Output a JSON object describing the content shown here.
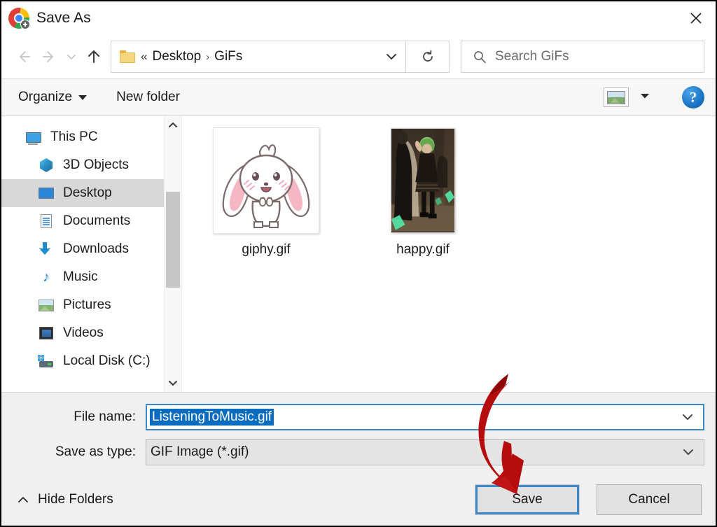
{
  "window": {
    "title": "Save As",
    "app_icon": "chrome-icon",
    "close_label": "✕"
  },
  "nav": {
    "back_icon": "arrow-left-icon",
    "forward_icon": "arrow-right-icon",
    "recent_icon": "chevron-down-icon",
    "up_icon": "arrow-up-icon",
    "refresh_icon": "refresh-icon",
    "address": {
      "folder_icon": "folder-icon",
      "prefix": "«",
      "crumbs": [
        "Desktop",
        "GiFs"
      ],
      "separator": "›",
      "dropdown_icon": "chevron-down-icon"
    },
    "search": {
      "icon": "search-icon",
      "placeholder": "Search GiFs",
      "value": ""
    }
  },
  "toolbar": {
    "organize_label": "Organize",
    "new_folder_label": "New folder",
    "view_icon": "picture-view-icon",
    "view_dropdown_icon": "chevron-down-icon",
    "help_label": "?",
    "help_icon": "help-icon"
  },
  "sidebar": {
    "items": [
      {
        "label": "This PC",
        "icon": "pc-icon",
        "indent": false,
        "selected": false
      },
      {
        "label": "3D Objects",
        "icon": "cube-icon",
        "indent": true,
        "selected": false
      },
      {
        "label": "Desktop",
        "icon": "desktop-icon",
        "indent": true,
        "selected": true
      },
      {
        "label": "Documents",
        "icon": "document-icon",
        "indent": true,
        "selected": false
      },
      {
        "label": "Downloads",
        "icon": "download-icon",
        "indent": true,
        "selected": false
      },
      {
        "label": "Music",
        "icon": "music-note-icon",
        "indent": true,
        "selected": false
      },
      {
        "label": "Pictures",
        "icon": "picture-icon",
        "indent": true,
        "selected": false
      },
      {
        "label": "Videos",
        "icon": "video-icon",
        "indent": true,
        "selected": false
      },
      {
        "label": "Local Disk (C:)",
        "icon": "disk-icon",
        "indent": true,
        "selected": false
      }
    ],
    "scrollbar": {
      "up_icon": "chevron-up-icon",
      "down_icon": "chevron-down-icon"
    }
  },
  "files": [
    {
      "name": "giphy.gif",
      "thumb": "white-bunny-illustration"
    },
    {
      "name": "happy.gif",
      "thumb": "dark-anime-scene"
    }
  ],
  "form": {
    "filename_label": "File name:",
    "filename_value": "ListeningToMusic.gif",
    "filename_selected": true,
    "filetype_label": "Save as type:",
    "filetype_value": "GIF Image (*.gif)",
    "dropdown_icon": "chevron-down-icon"
  },
  "footer": {
    "hide_folders_label": "Hide Folders",
    "hide_folders_icon": "chevron-up-icon",
    "save_label": "Save",
    "cancel_label": "Cancel"
  },
  "annotation": {
    "arrow_color": "#b50d0d",
    "points_to": "save-button"
  }
}
